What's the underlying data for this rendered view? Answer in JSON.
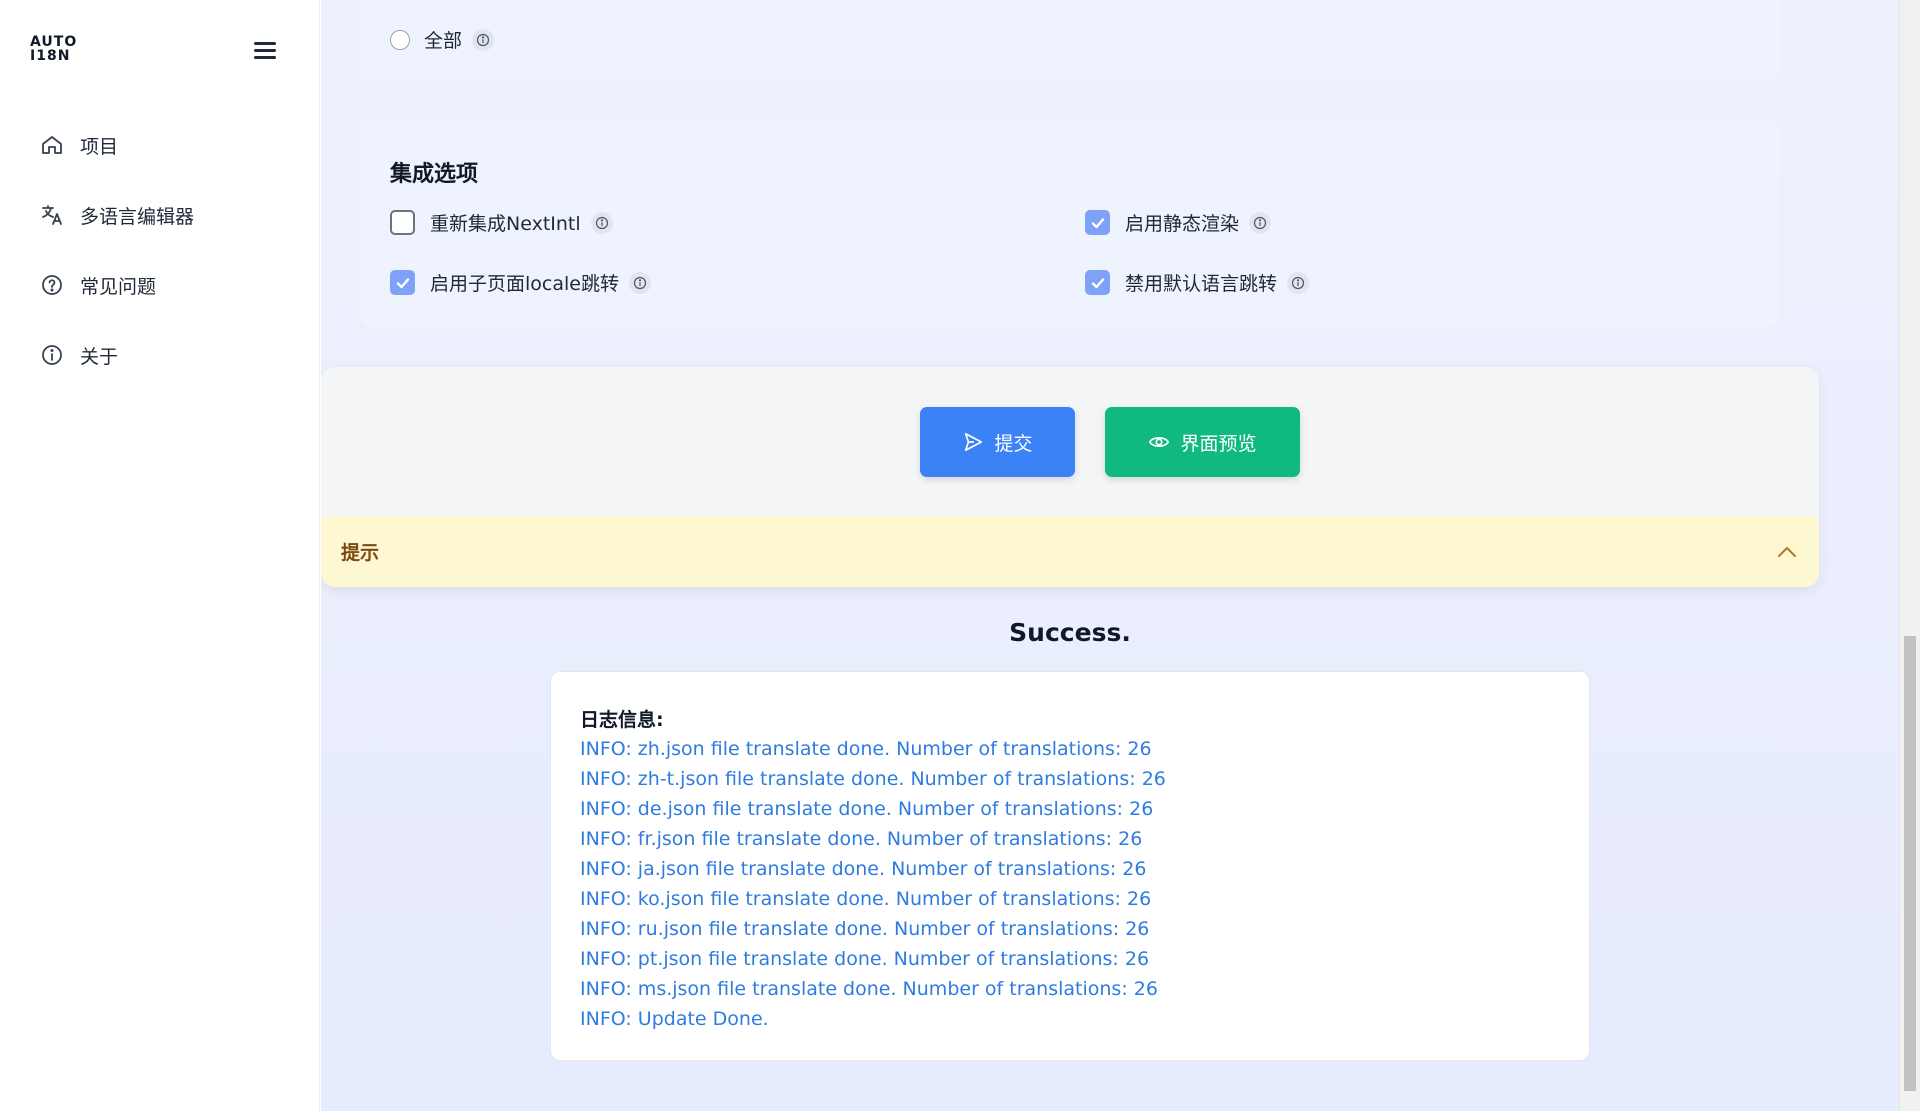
{
  "sidebar": {
    "logo_line1": "AUTO",
    "logo_line2": "I18N",
    "items": [
      {
        "label": "项目",
        "icon": "home-icon"
      },
      {
        "label": "多语言编辑器",
        "icon": "translate-icon"
      },
      {
        "label": "常见问题",
        "icon": "question-icon"
      },
      {
        "label": "关于",
        "icon": "info-icon"
      }
    ]
  },
  "scope": {
    "all_label": "全部"
  },
  "integration": {
    "title": "集成选项",
    "options": [
      {
        "label": "重新集成NextIntl",
        "checked": false
      },
      {
        "label": "启用静态渲染",
        "checked": true
      },
      {
        "label": "启用子页面locale跳转",
        "checked": true
      },
      {
        "label": "禁用默认语言跳转",
        "checked": true
      }
    ]
  },
  "actions": {
    "submit_label": "提交",
    "preview_label": "界面预览",
    "submit_color": "#3b82f6",
    "preview_color": "#10b981"
  },
  "tip": {
    "label": "提示"
  },
  "result": {
    "status": "Success.",
    "log_title": "日志信息:",
    "log_lines": [
      "INFO: zh.json file translate done. Number of translations: 26",
      "INFO: zh-t.json file translate done. Number of translations: 26",
      "INFO: de.json file translate done. Number of translations: 26",
      "INFO: fr.json file translate done. Number of translations: 26",
      "INFO: ja.json file translate done. Number of translations: 26",
      "INFO: ko.json file translate done. Number of translations: 26",
      "INFO: ru.json file translate done. Number of translations: 26",
      "INFO: pt.json file translate done. Number of translations: 26",
      "INFO: ms.json file translate done. Number of translations: 26",
      "INFO: Update Done."
    ]
  }
}
